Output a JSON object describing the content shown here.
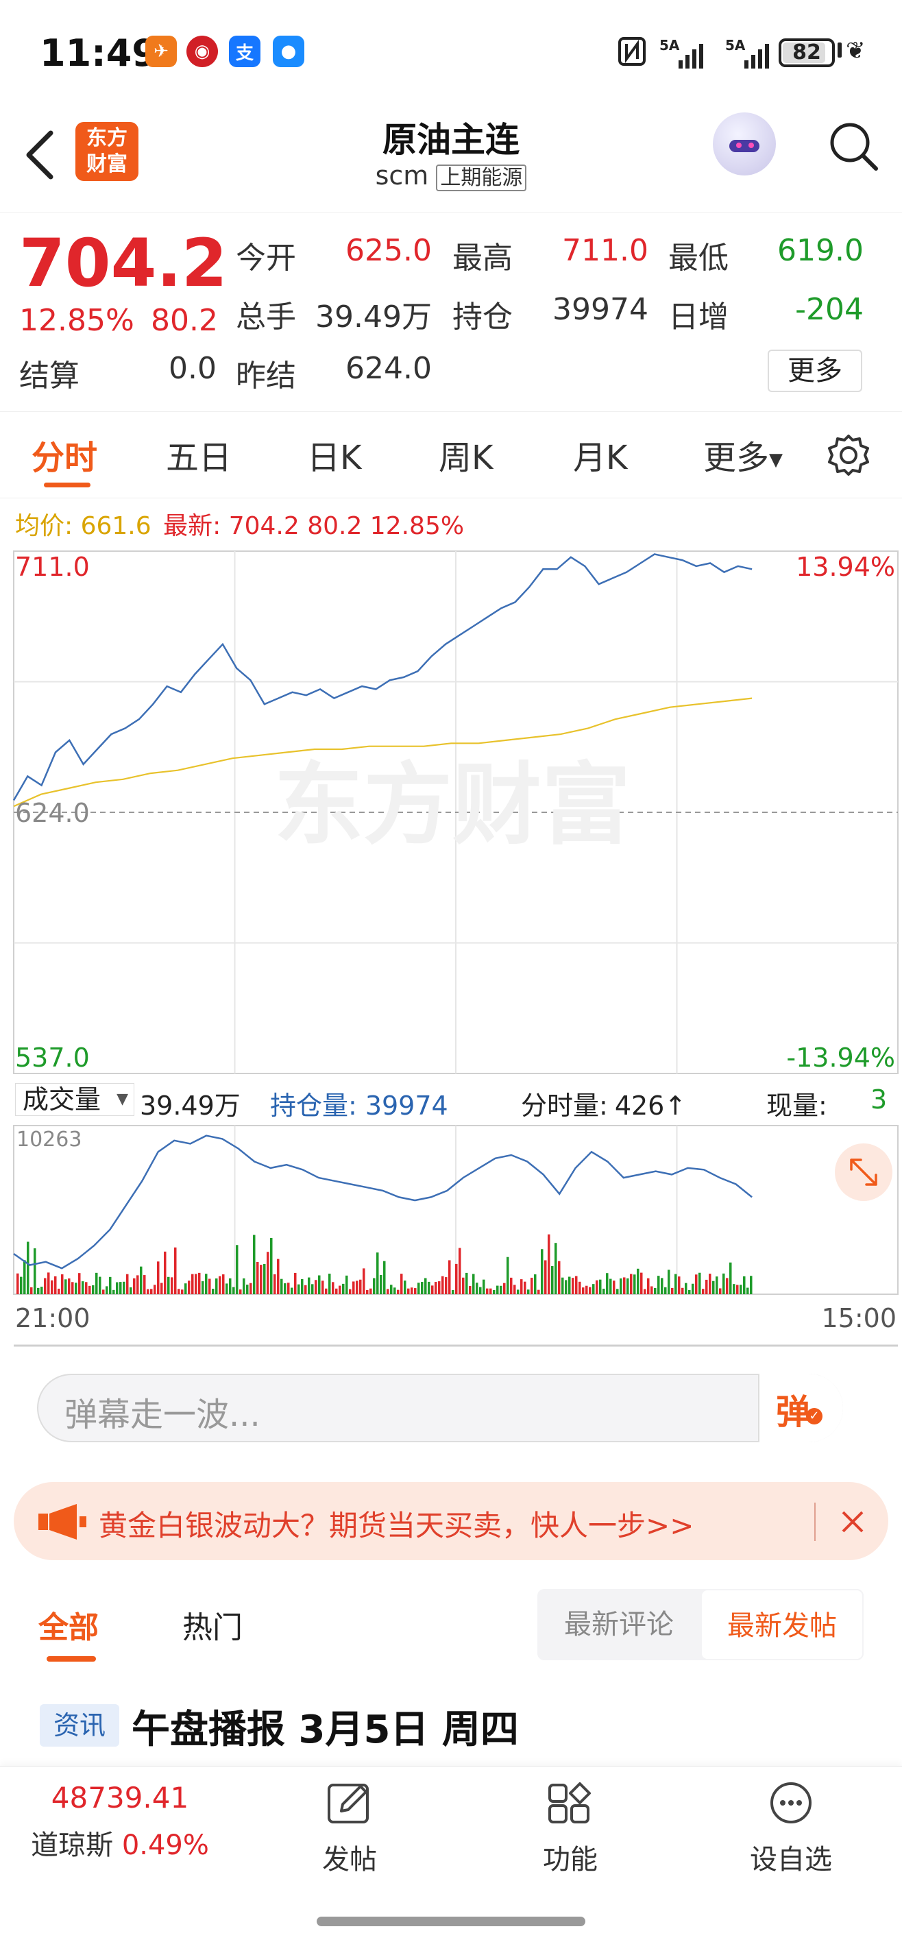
{
  "status_bar": {
    "time": "11:49",
    "battery": "82",
    "signal1": "5A",
    "signal2": "5A"
  },
  "header": {
    "title": "原油主连",
    "code": "scm",
    "exchange": "上期能源",
    "logo_line1": "东方",
    "logo_line2": "财富"
  },
  "quote": {
    "price": "704.2",
    "change_pct": "12.85%",
    "change": "80.2",
    "open_label": "今开",
    "open": "625.0",
    "high_label": "最高",
    "high": "711.0",
    "low_label": "最低",
    "low": "619.0",
    "volume_label": "总手",
    "volume": "39.49万",
    "oi_label": "持仓",
    "oi": "39974",
    "daily_inc_label": "日增",
    "daily_inc": "-204",
    "settle_label": "结算",
    "settle": "0.0",
    "prev_settle_label": "昨结",
    "prev_settle": "624.0",
    "more_button": "更多"
  },
  "tabs": [
    "分时",
    "五日",
    "日K",
    "周K",
    "月K",
    "更多"
  ],
  "chart_info": {
    "avg_label": "均价:",
    "avg": "661.6",
    "latest_label": "最新:",
    "latest": "704.2 80.2 12.85%"
  },
  "chart_data": [
    {
      "type": "line",
      "y_left_ticks": [
        "711.0",
        "624.0",
        "537.0"
      ],
      "y_right_ticks": [
        "13.94%",
        "-13.94%"
      ],
      "x_ticks": [
        "21:00",
        "15:00"
      ],
      "ylim": [
        537.0,
        711.0
      ],
      "reference": 624.0,
      "watermark": "东方财富",
      "series": [
        {
          "color": "#3d6fb5",
          "values": [
            628,
            636,
            633,
            644,
            648,
            640,
            645,
            650,
            652,
            655,
            660,
            666,
            664,
            670,
            675,
            680,
            672,
            668,
            660,
            662,
            664,
            663,
            665,
            662,
            664,
            666,
            665,
            668,
            669,
            671,
            676,
            680,
            683,
            686,
            689,
            692,
            694,
            699,
            705,
            705,
            709,
            706,
            700,
            702,
            704,
            707,
            710,
            709,
            708,
            706,
            707,
            704,
            706,
            705
          ]
        },
        {
          "color": "#e8c22c",
          "values": [
            626,
            630,
            632,
            634,
            635,
            637,
            638,
            640,
            642,
            643,
            644,
            645,
            645,
            646,
            646,
            646,
            647,
            647,
            648,
            649,
            650,
            652,
            655,
            657,
            659,
            660,
            661,
            662
          ]
        }
      ]
    },
    {
      "type": "bar",
      "label_top": "10263",
      "volume_label": "成交量",
      "volume": "39.49万",
      "oi_label": "持仓量:",
      "oi": "39974",
      "tick_vol_label": "分时量:",
      "tick_vol": "426↑",
      "current_label": "现量:",
      "current": "3"
    }
  ],
  "danmaku": {
    "placeholder": "弹幕走一波...",
    "button": "弹"
  },
  "ad": {
    "text": "黄金白银波动大？期货当天买卖，快人一步>>"
  },
  "comment_tabs": {
    "all": "全部",
    "hot": "热门",
    "newest_comment": "最新评论",
    "newest_post": "最新发帖"
  },
  "news": {
    "tag": "资讯",
    "title": "午盘播报 3月5日 周四"
  },
  "bottom_nav": {
    "index_value": "48739.41",
    "index_name": "道琼斯",
    "index_pct": "0.49%",
    "post": "发帖",
    "function": "功能",
    "add": "设自选"
  }
}
